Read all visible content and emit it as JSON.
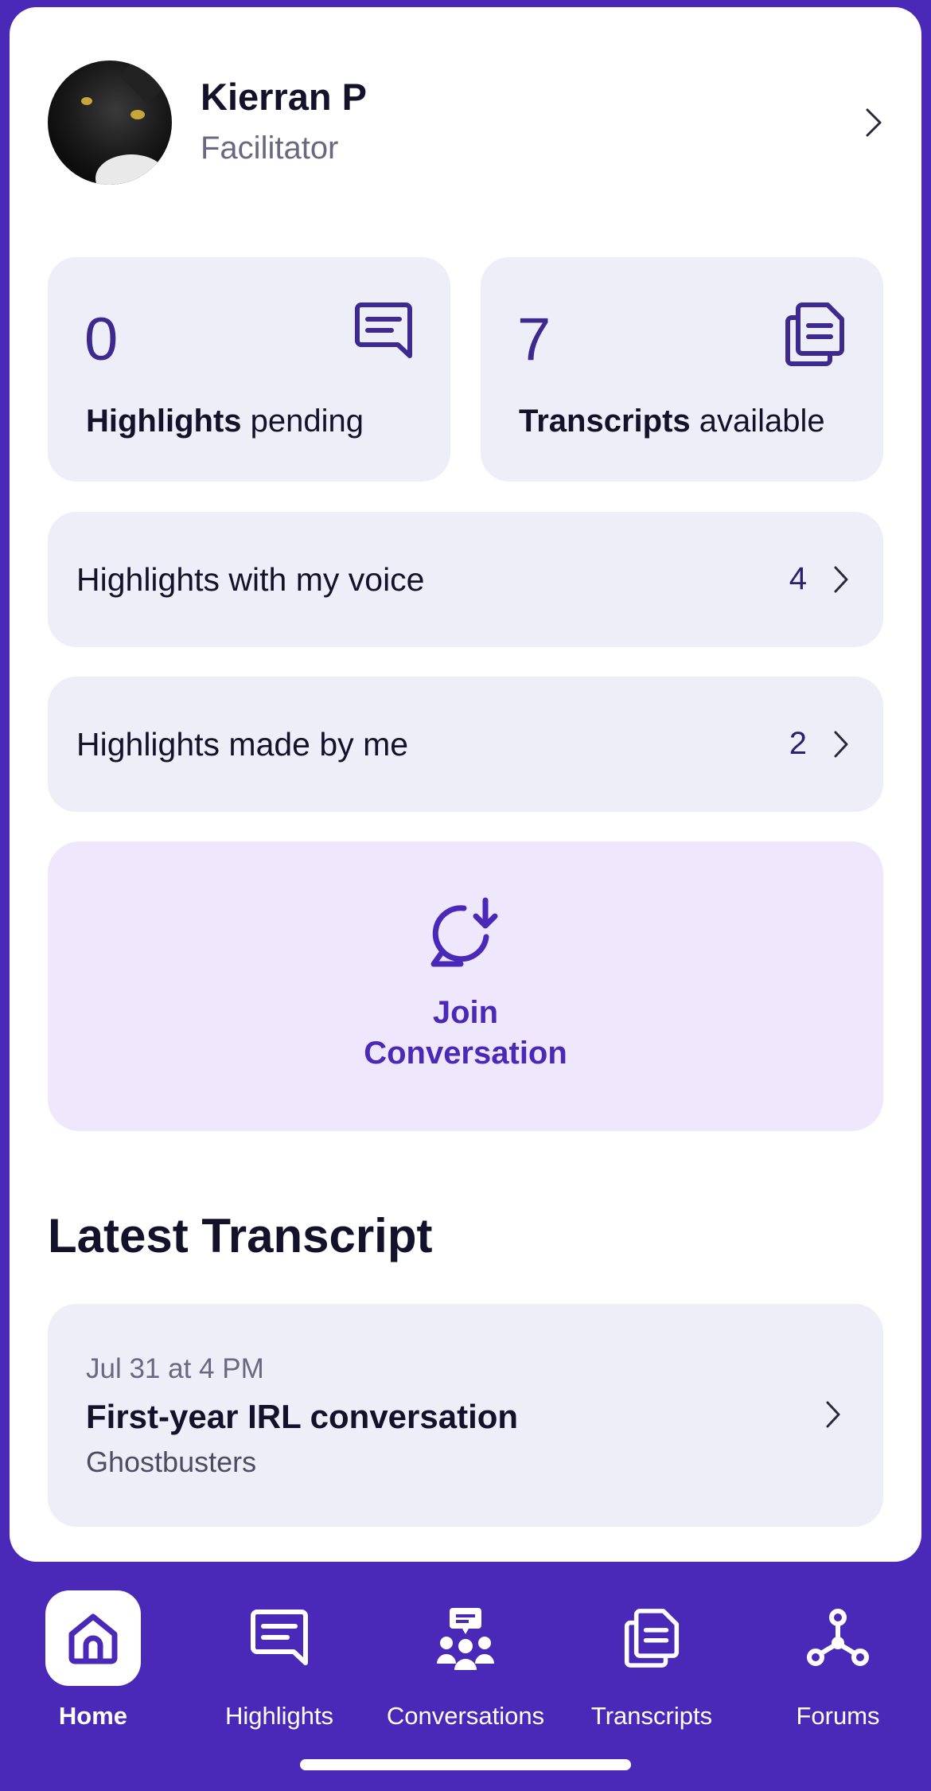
{
  "profile": {
    "name": "Kierran P",
    "role": "Facilitator"
  },
  "stats": [
    {
      "value": "0",
      "label_bold": "Highlights",
      "label_rest": " pending",
      "icon": "highlight-icon"
    },
    {
      "value": "7",
      "label_bold": "Transcripts",
      "label_rest": " available",
      "icon": "transcript-icon"
    }
  ],
  "rows": [
    {
      "label": "Highlights with my voice",
      "count": "4"
    },
    {
      "label": "Highlights made by me",
      "count": "2"
    }
  ],
  "join": {
    "line1": "Join",
    "line2": "Conversation",
    "icon": "chat-download-icon"
  },
  "latest": {
    "title": "Latest Transcript",
    "date": "Jul 31 at 4 PM",
    "name": "First-year IRL conversation",
    "subtitle": "Ghostbusters"
  },
  "tabs": [
    {
      "label": "Home",
      "icon": "home-icon",
      "active": true
    },
    {
      "label": "Highlights",
      "icon": "highlight-icon",
      "active": false
    },
    {
      "label": "Conversations",
      "icon": "conversations-icon",
      "active": false
    },
    {
      "label": "Transcripts",
      "icon": "transcript-icon",
      "active": false
    },
    {
      "label": "Forums",
      "icon": "forums-icon",
      "active": false
    }
  ],
  "colors": {
    "brand": "#4b29b8",
    "tile_bg": "#eeeef8",
    "join_bg": "#efe7fc",
    "text": "#14112b",
    "muted": "#6a6880"
  }
}
